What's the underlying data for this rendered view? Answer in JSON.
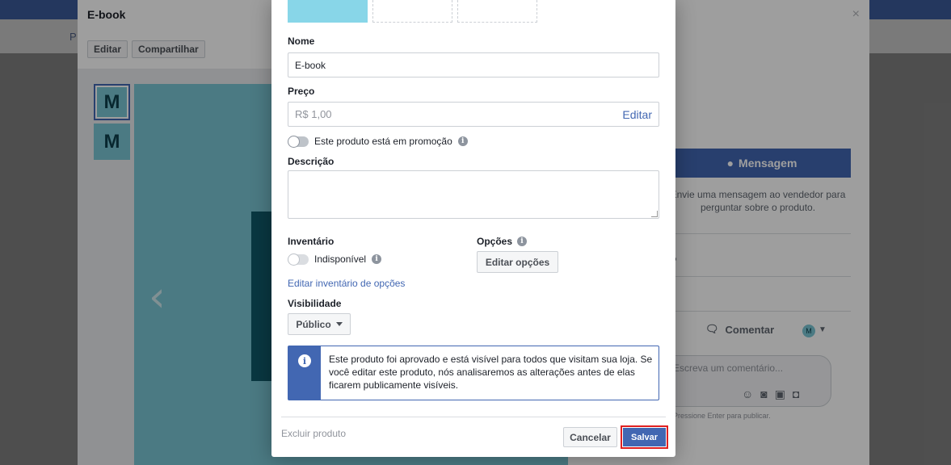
{
  "background": {
    "page_text": "P"
  },
  "viewer": {
    "title": "E-book",
    "close": "×",
    "edit_button": "Editar",
    "share_button": "Compartilhar",
    "thumbnails": [
      "M",
      "M"
    ],
    "message_button": "Mensagem",
    "message_text": "Envie uma mensagem ao vendedor para perguntar sobre o produto.",
    "comment_label": "Comentar",
    "avatar_letter": "M",
    "comment_placeholder": "Escreva um comentário...",
    "publish_hint": "Pressione Enter para publicar."
  },
  "modal": {
    "name_label": "Nome",
    "name_value": "E-book",
    "price_label": "Preço",
    "price_value": "R$ 1,00",
    "price_edit_link": "Editar",
    "promo_toggle_label": "Este produto está em promoção",
    "description_label": "Descrição",
    "description_value": "",
    "inventory_label": "Inventário",
    "inventory_toggle_label": "Indisponível",
    "inventory_link": "Editar inventário de opções",
    "options_label": "Opções",
    "options_button": "Editar opções",
    "visibility_label": "Visibilidade",
    "visibility_value": "Público",
    "notice_text": "Este produto foi aprovado e está visível para todos que visitam sua loja. Se você editar este produto, nós analisaremos as alterações antes de elas ficarem publicamente visíveis.",
    "delete_link": "Excluir produto",
    "cancel_button": "Cancelar",
    "save_button": "Salvar"
  },
  "colors": {
    "accent": "#4267b2",
    "product_image": "#79c5d3",
    "highlight_border": "#e02020"
  }
}
